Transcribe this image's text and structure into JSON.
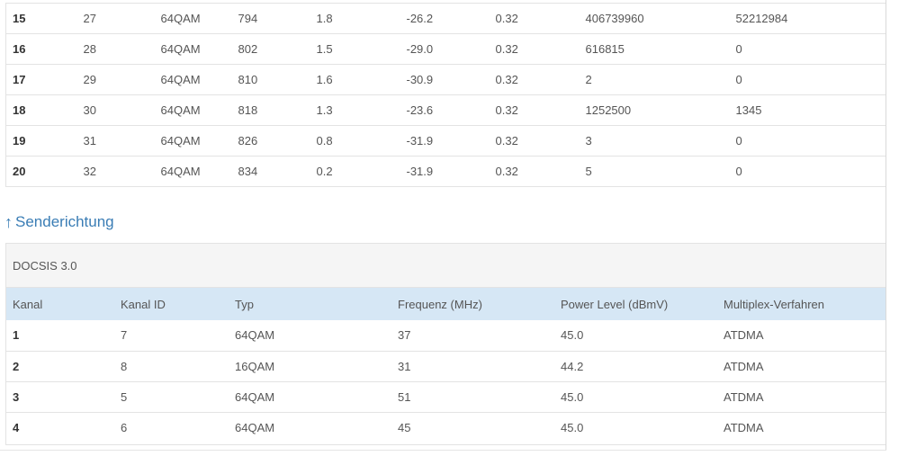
{
  "downstream": {
    "rows": [
      [
        "15",
        "27",
        "64QAM",
        "794",
        "1.8",
        "-26.2",
        "0.32",
        "406739960",
        "52212984"
      ],
      [
        "16",
        "28",
        "64QAM",
        "802",
        "1.5",
        "-29.0",
        "0.32",
        "616815",
        "0"
      ],
      [
        "17",
        "29",
        "64QAM",
        "810",
        "1.6",
        "-30.9",
        "0.32",
        "2",
        "0"
      ],
      [
        "18",
        "30",
        "64QAM",
        "818",
        "1.3",
        "-23.6",
        "0.32",
        "1252500",
        "1345"
      ],
      [
        "19",
        "31",
        "64QAM",
        "826",
        "0.8",
        "-31.9",
        "0.32",
        "3",
        "0"
      ],
      [
        "20",
        "32",
        "64QAM",
        "834",
        "0.2",
        "-31.9",
        "0.32",
        "5",
        "0"
      ]
    ]
  },
  "upstream": {
    "heading": "Senderichtung",
    "heading_icon": "arrow-up-icon",
    "card_title": "DOCSIS 3.0",
    "columns": [
      "Kanal",
      "Kanal ID",
      "Typ",
      "Frequenz (MHz)",
      "Power Level (dBmV)",
      "Multiplex-Verfahren"
    ],
    "rows": [
      [
        "1",
        "7",
        "64QAM",
        "37",
        "45.0",
        "ATDMA"
      ],
      [
        "2",
        "8",
        "16QAM",
        "31",
        "44.2",
        "ATDMA"
      ],
      [
        "3",
        "5",
        "64QAM",
        "51",
        "45.0",
        "ATDMA"
      ],
      [
        "4",
        "6",
        "64QAM",
        "45",
        "45.0",
        "ATDMA"
      ]
    ]
  },
  "colors": {
    "heading": "#3a7db5",
    "header_row_bg": "#d6e7f5",
    "card_header_bg": "#f5f5f5",
    "border": "#e3e3e3"
  }
}
